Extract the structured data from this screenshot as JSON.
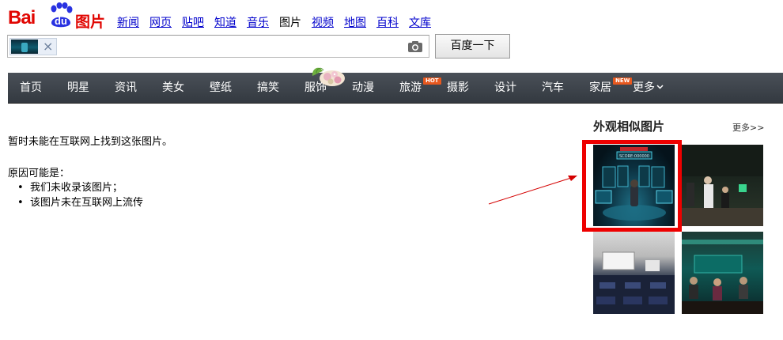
{
  "logo": {
    "text_bai": "Bai",
    "text_du": "du",
    "text_pic": "图片"
  },
  "topnav": [
    {
      "label": "新闻",
      "current": false
    },
    {
      "label": "网页",
      "current": false
    },
    {
      "label": "贴吧",
      "current": false
    },
    {
      "label": "知道",
      "current": false
    },
    {
      "label": "音乐",
      "current": false
    },
    {
      "label": "图片",
      "current": true
    },
    {
      "label": "视频",
      "current": false
    },
    {
      "label": "地图",
      "current": false
    },
    {
      "label": "百科",
      "current": false
    },
    {
      "label": "文库",
      "current": false
    }
  ],
  "search": {
    "clear_glyph": "×",
    "camera_icon": "camera-icon",
    "button_label": "百度一下"
  },
  "categories": [
    {
      "label": "首页"
    },
    {
      "label": "明星"
    },
    {
      "label": "资讯"
    },
    {
      "label": "美女"
    },
    {
      "label": "壁纸"
    },
    {
      "label": "搞笑"
    },
    {
      "label": "服饰"
    },
    {
      "label": "动漫"
    },
    {
      "label": "旅游",
      "badge": "HOT"
    },
    {
      "label": "摄影"
    },
    {
      "label": "设计"
    },
    {
      "label": "汽车"
    },
    {
      "label": "家居",
      "badge": "NEW"
    },
    {
      "label": "更多",
      "dropdown": true
    }
  ],
  "main": {
    "message": "暂时未能在互联网上找到这张图片。",
    "reason_title": "原因可能是：",
    "reasons": [
      "我们未收录该图片；",
      "该图片未在互联网上流传"
    ]
  },
  "similar": {
    "title": "外观相似图片",
    "more_label": "更多>>",
    "t1_score": "SCORE:000000"
  },
  "colors": {
    "brand_red": "#e10602",
    "link_blue": "#0000cc",
    "catbar": "#3d434a",
    "highlight": "#ee0000",
    "hot_badge": "#e8581e"
  }
}
